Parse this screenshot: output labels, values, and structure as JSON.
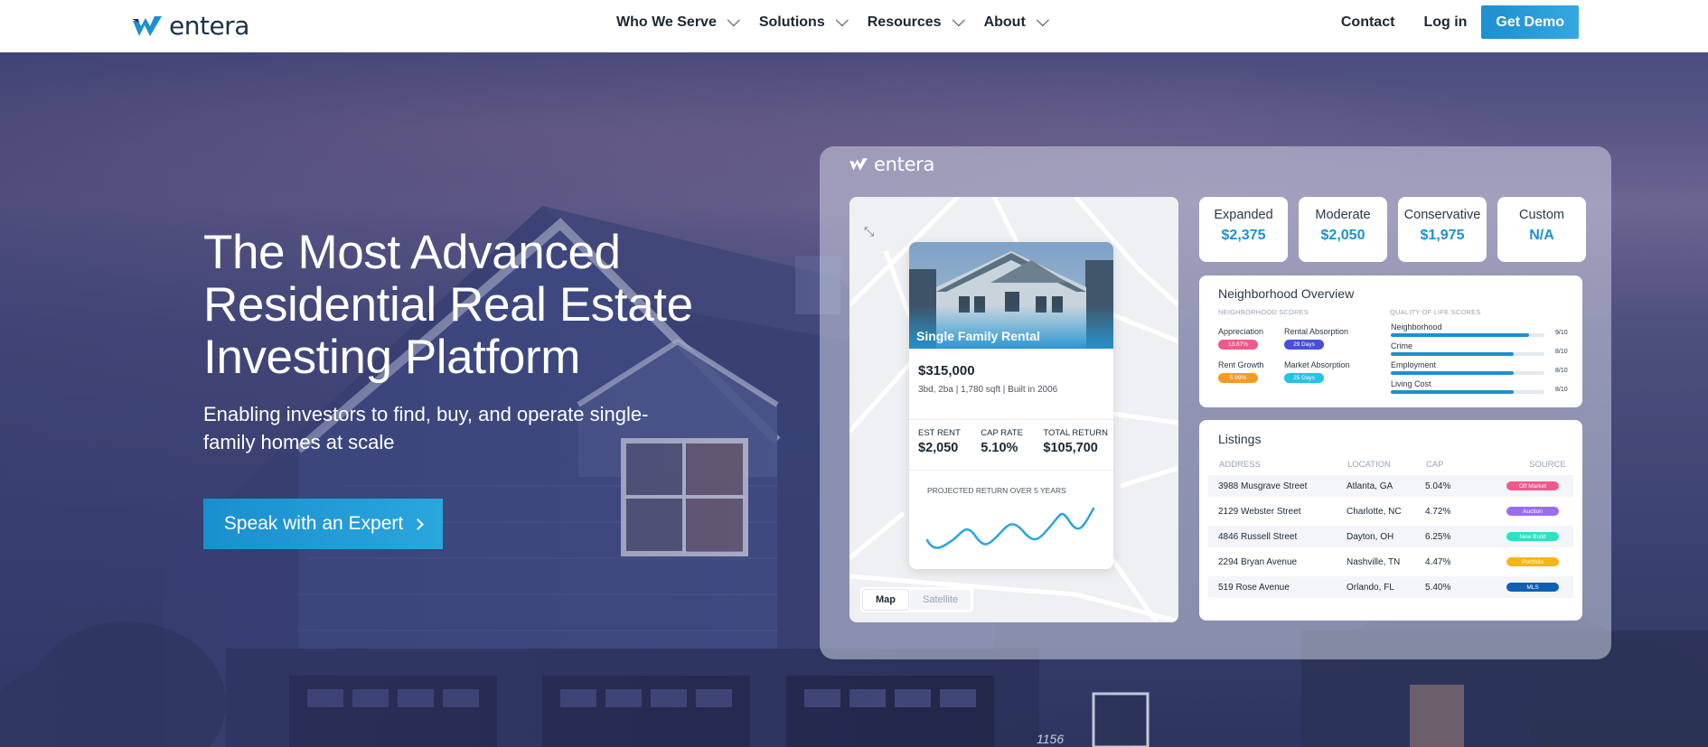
{
  "brand": {
    "name": "entera",
    "primary": "#1e8fcf",
    "dark": "#1c3145"
  },
  "nav": {
    "menu": [
      {
        "label": "Who We Serve",
        "icon": "chevron-down-icon"
      },
      {
        "label": "Solutions",
        "icon": "chevron-down-icon"
      },
      {
        "label": "Resources",
        "icon": "chevron-down-icon"
      },
      {
        "label": "About",
        "icon": "chevron-down-icon"
      }
    ],
    "contact": "Contact",
    "login": "Log in",
    "demo": "Get Demo"
  },
  "hero": {
    "headline": "The Most Advanced Residential Real Estate Investing Platform",
    "subhead": "Enabling investors to find, buy, and operate single-family homes at scale",
    "cta": "Speak with an Expert"
  },
  "dashboard": {
    "logo": "entera",
    "map": {
      "toggle": [
        "Map",
        "Satellite"
      ],
      "selected": "Map"
    },
    "property": {
      "type": "Single Family Rental",
      "price": "$315,000",
      "specs": "3bd, 2ba | 1,780 sqft | Built in 2006",
      "metrics": [
        {
          "label": "EST RENT",
          "value": "$2,050"
        },
        {
          "label": "CAP RATE",
          "value": "5.10%"
        },
        {
          "label": "TOTAL RETURN",
          "value": "$105,700"
        }
      ],
      "projection_label": "PROJECTED RETURN OVER 5 YEARS"
    },
    "tiers": [
      {
        "label": "Expanded",
        "value": "$2,375"
      },
      {
        "label": "Moderate",
        "value": "$2,050"
      },
      {
        "label": "Conservative",
        "value": "$1,975"
      },
      {
        "label": "Custom",
        "value": "N/A"
      }
    ],
    "neighborhood": {
      "title": "Neighborhood Overview",
      "scores_label": "NEIGHBORHOOD SCORES",
      "quality_label": "QUALITY OF LIFE SCORES",
      "scores": [
        {
          "label": "Appreciation",
          "pill": "13.67%",
          "color": "#f05a8a"
        },
        {
          "label": "Rental Absorption",
          "pill": "29 Days",
          "color": "#4a4fd8"
        },
        {
          "label": "Rent Growth",
          "pill": "5.99%",
          "color": "#f79b25"
        },
        {
          "label": "Market Absorption",
          "pill": "25 Days",
          "color": "#26c2e8"
        }
      ],
      "quality": [
        {
          "label": "Neighborhood",
          "value": "9/10",
          "level": 0.9
        },
        {
          "label": "Crime",
          "value": "8/10",
          "level": 0.8
        },
        {
          "label": "Employment",
          "value": "8/10",
          "level": 0.8
        },
        {
          "label": "Living Cost",
          "value": "8/10",
          "level": 0.8
        }
      ]
    },
    "listings": {
      "title": "Listings",
      "columns": [
        "ADDRESS",
        "LOCATION",
        "CAP",
        "SOURCE"
      ],
      "rows": [
        {
          "address": "3988 Musgrave Street",
          "location": "Atlanta, GA",
          "cap": "5.04%",
          "source": "Off Market",
          "color": "#f05a8a"
        },
        {
          "address": "2129 Webster Street",
          "location": "Charlotte, NC",
          "cap": "4.72%",
          "source": "Auction",
          "color": "#9b6cf0"
        },
        {
          "address": "4846 Russell Street",
          "location": "Dayton, OH",
          "cap": "6.25%",
          "source": "New Build",
          "color": "#2fe0c3"
        },
        {
          "address": "2294 Bryan Avenue",
          "location": "Nashville, TN",
          "cap": "4.47%",
          "source": "Portfolio",
          "color": "#f7b51b"
        },
        {
          "address": "519 Rose Avenue",
          "location": "Orlando, FL",
          "cap": "5.40%",
          "source": "MLS",
          "color": "#0f5fb3"
        }
      ]
    }
  },
  "backdrop": {
    "house_number": "1156"
  }
}
